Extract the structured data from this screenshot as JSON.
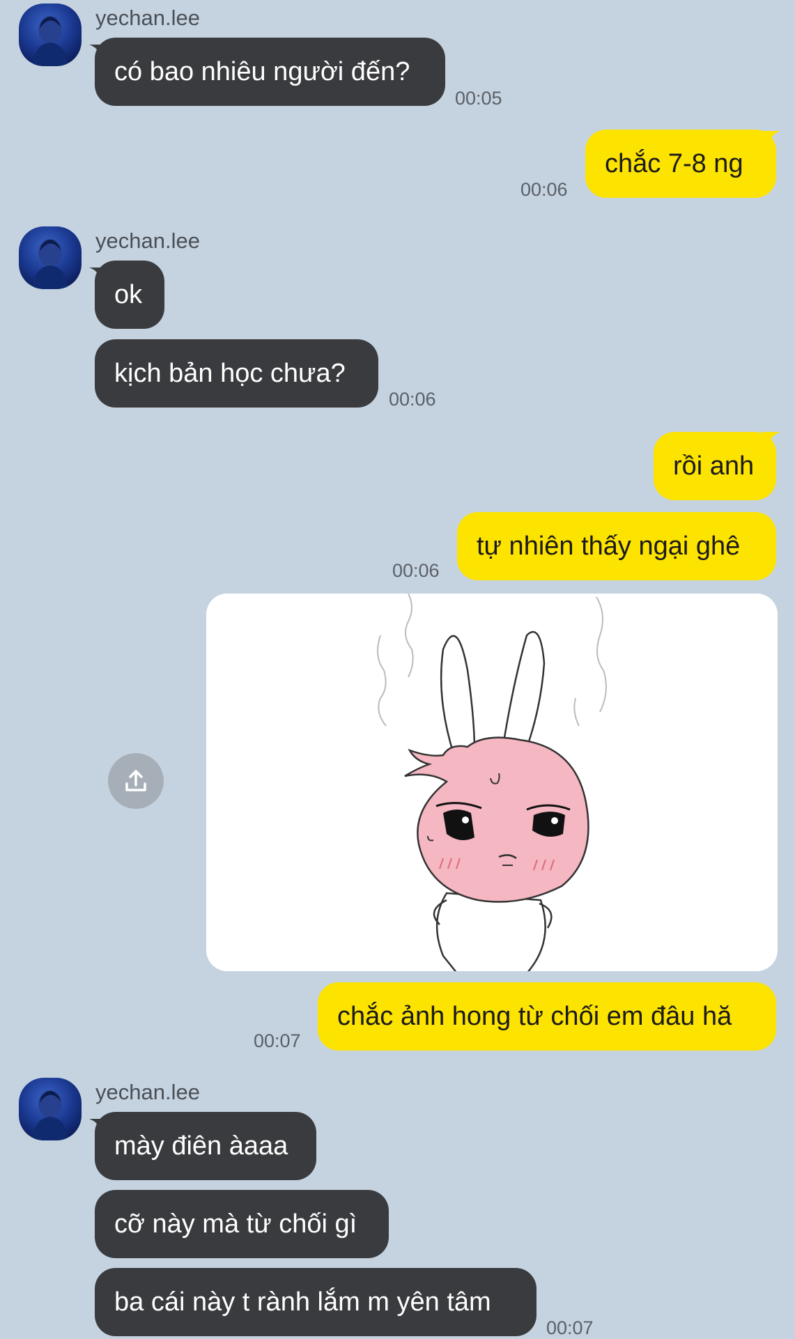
{
  "chat": {
    "partner_name": "yechan.lee",
    "messages": [
      {
        "text": "có bao nhiêu người đến?"
      },
      {
        "text": "chắc 7-8 ng"
      },
      {
        "text": "ok"
      },
      {
        "text": "kịch bản học chưa?"
      },
      {
        "text": "rồi anh"
      },
      {
        "text": "tự nhiên thấy ngại ghê"
      },
      {
        "text": "chắc ảnh hong từ chối em đâu hă"
      },
      {
        "text": "mày điên àaaa"
      },
      {
        "text": "cỡ này mà từ chối gì"
      },
      {
        "text": "ba cái này t rành lắm m yên tâm"
      }
    ],
    "times": {
      "t1": "00:05",
      "t2": "00:06",
      "t3": "00:06",
      "t4": "00:06",
      "t5": "00:07",
      "t6": "00:07"
    },
    "sticker": {
      "icon": "pink-bunny-sticker",
      "share_icon": "share-icon"
    }
  },
  "colors": {
    "background": "#c5d3e0",
    "incoming_bubble": "#3a3b3e",
    "outgoing_bubble": "#fde300",
    "share_button": "#a6afb8"
  }
}
